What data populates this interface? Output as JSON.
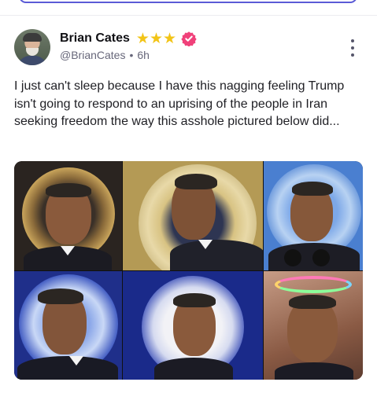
{
  "post": {
    "author_name": "Brian Cates",
    "handle": "@BrianCates",
    "separator": "•",
    "time": "6h",
    "star_count": 3,
    "verified": true,
    "text": "I just can't sleep because I have this nagging feeling Trump isn't going to respond to an uprising of the people in Iran seeking freedom the way this asshole pictured below did...",
    "image_alt": "Photo grid of six portraits"
  },
  "icons": {
    "avatar": "user-avatar",
    "stars": "star-icon",
    "verified": "verified-badge-icon",
    "more": "more-vertical-icon"
  },
  "colors": {
    "accent": "#5b5bd6",
    "star": "#f2c417",
    "verified": "#f0417a",
    "muted": "#67677a"
  }
}
